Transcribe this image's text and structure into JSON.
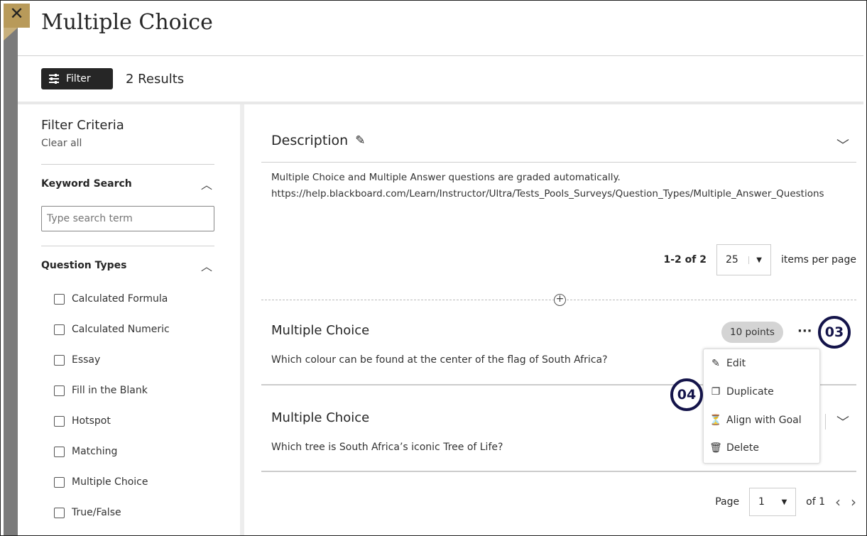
{
  "header": {
    "close_icon": "close-x-icon",
    "title": "Multiple Choice"
  },
  "toolbar": {
    "filter_label": "Filter",
    "results": "2 Results"
  },
  "sidebar": {
    "title": "Filter Criteria",
    "clear_all": "Clear all",
    "keyword_search": "Keyword Search",
    "search_placeholder": "Type search term",
    "question_types": "Question Types",
    "types": [
      "Calculated Formula",
      "Calculated Numeric",
      "Essay",
      "Fill in the Blank",
      "Hotspot",
      "Matching",
      "Multiple Choice",
      "True/False"
    ]
  },
  "description": {
    "title": "Description",
    "line1": "Multiple Choice and Multiple Answer questions are graded automatically.",
    "line2": "https://help.blackboard.com/Learn/Instructor/Ultra/Tests_Pools_Surveys/Question_Types/Multiple_Answer_Questions"
  },
  "pagination": {
    "range": "1-2 of 2",
    "per_page": "25",
    "items_per_page": "items per page"
  },
  "questions": [
    {
      "type": "Multiple Choice",
      "text": "Which colour can be found at the center of the flag of South Africa?",
      "points": "10 points"
    },
    {
      "type": "Multiple Choice",
      "text": "Which tree is South Africa’s iconic Tree of Life?"
    }
  ],
  "menu": {
    "items": [
      "Edit",
      "Duplicate",
      "Align with Goal",
      "Delete"
    ]
  },
  "callouts": {
    "a": "03",
    "b": "04"
  },
  "footer": {
    "page_label": "Page",
    "page": "1",
    "of": "of 1"
  },
  "colors": {
    "accent_gold": "#b89a5a",
    "callout": "#14144a"
  }
}
